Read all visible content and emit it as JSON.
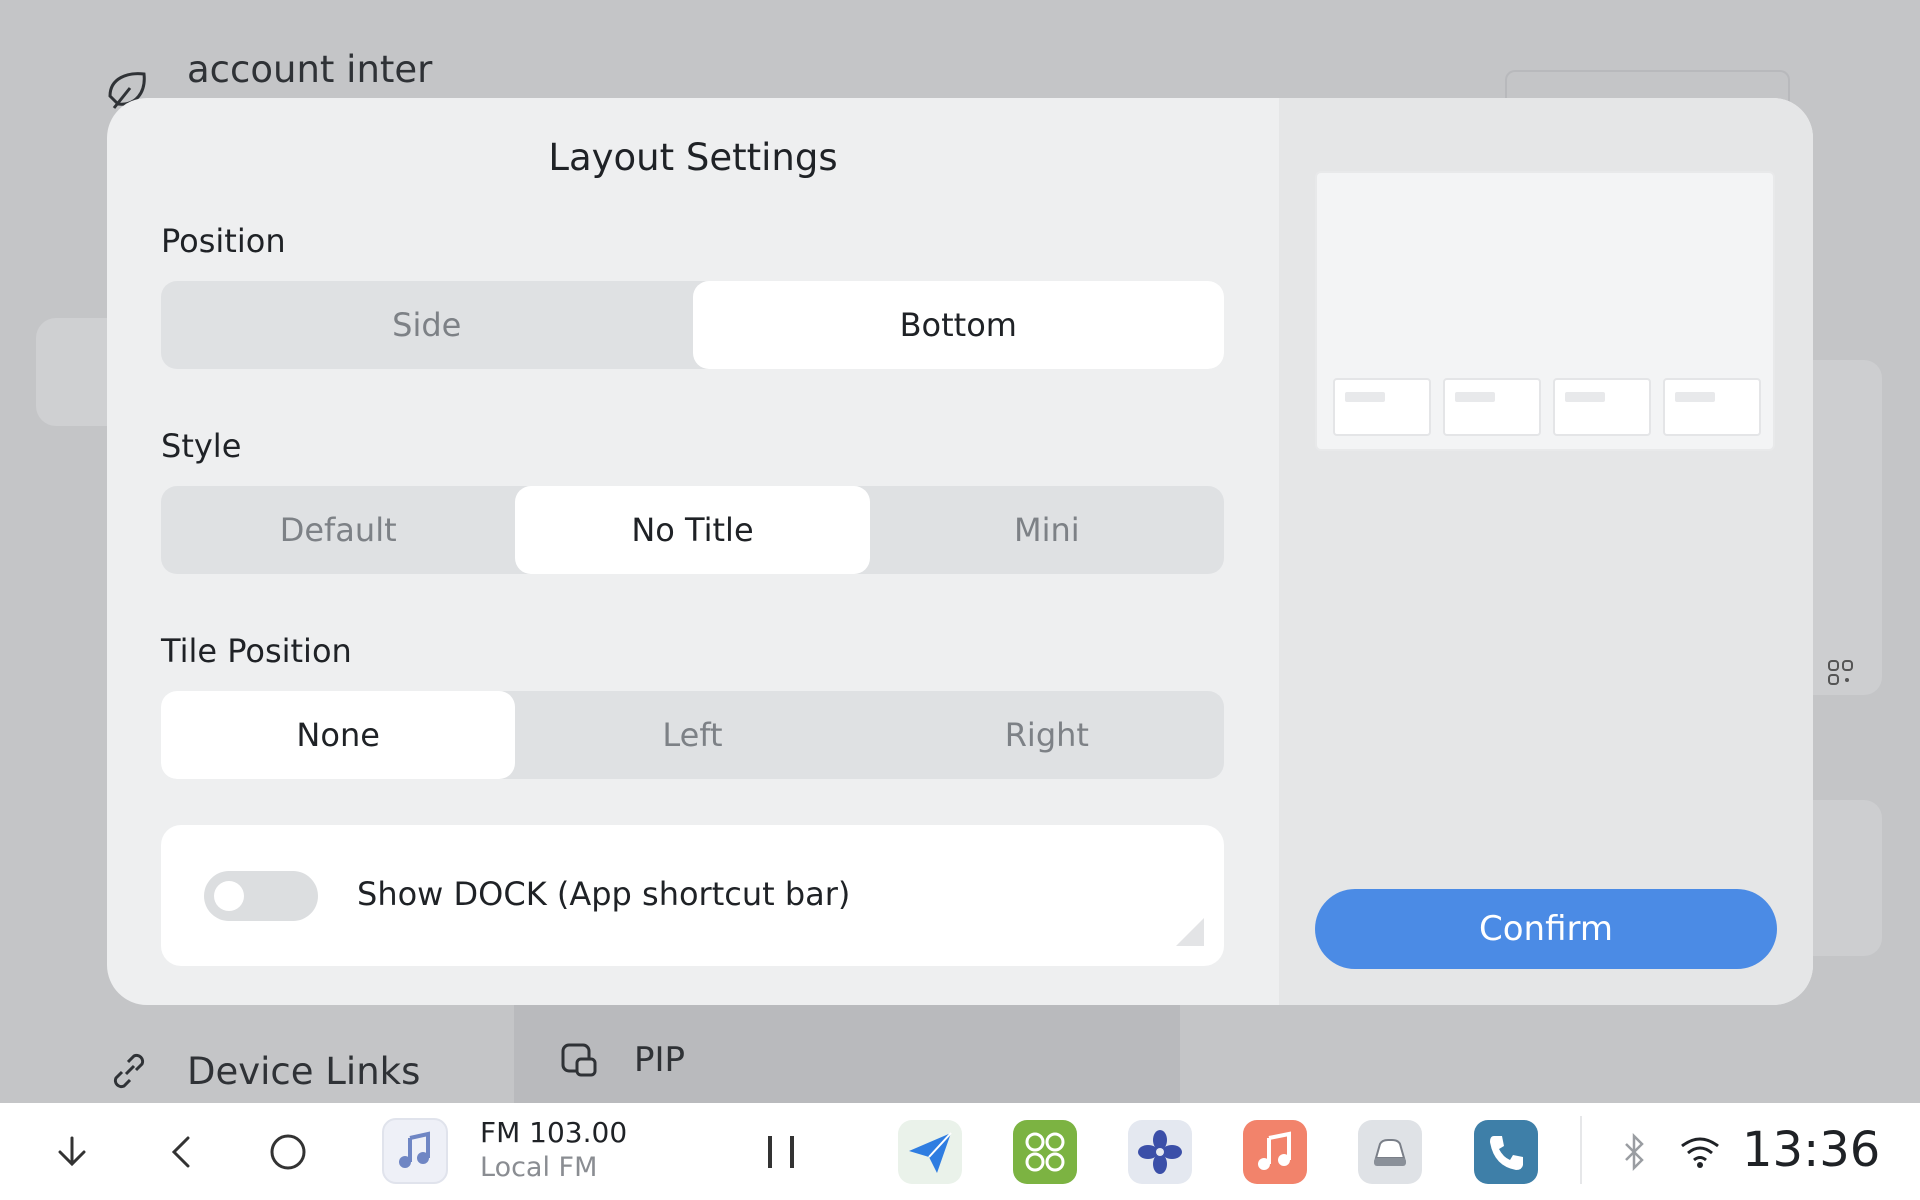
{
  "background": {
    "account_label": "account inter",
    "device_links_label": "Device Links",
    "pip_label": "PIP"
  },
  "dialog": {
    "title": "Layout Settings",
    "position": {
      "label": "Position",
      "options": [
        "Side",
        "Bottom"
      ],
      "selected": "Bottom"
    },
    "style": {
      "label": "Style",
      "options": [
        "Default",
        "No Title",
        "Mini"
      ],
      "selected": "No Title"
    },
    "tile_position": {
      "label": "Tile Position",
      "options": [
        "None",
        "Left",
        "Right"
      ],
      "selected": "None"
    },
    "dock": {
      "label": "Show DOCK (App shortcut bar)",
      "enabled": false
    },
    "confirm_label": "Confirm"
  },
  "taskbar": {
    "media_title": "FM 103.00",
    "media_subtitle": "Local FM",
    "time": "13:36",
    "apps": [
      "navigation-app-icon",
      "apps-grid-app-icon",
      "fan-app-icon",
      "music-app-icon",
      "car-app-icon",
      "phone-app-icon"
    ]
  },
  "colors": {
    "accent": "#4b8be5",
    "dialog_bg": "#eeeff0",
    "segment_bg": "#dfe1e3",
    "music_app": "#f2836b",
    "apps_app": "#7cb342",
    "phone_app": "#3e7fa8"
  }
}
